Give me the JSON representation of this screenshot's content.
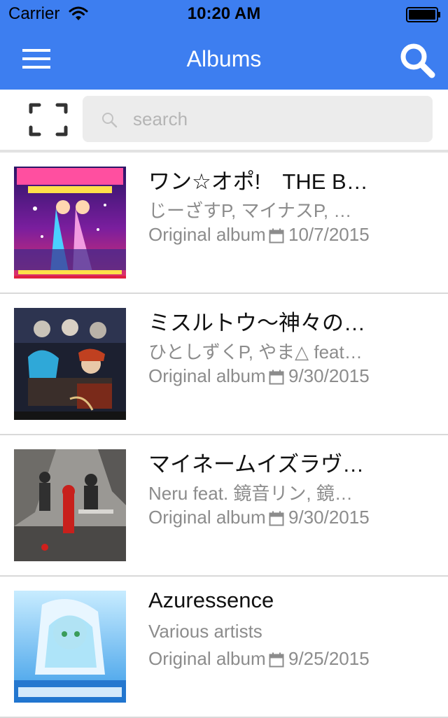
{
  "status_bar": {
    "carrier": "Carrier",
    "time": "10:20 AM"
  },
  "nav": {
    "title": "Albums",
    "menu_icon": "hamburger-menu-icon",
    "search_icon": "search-icon"
  },
  "search": {
    "placeholder": "search",
    "value": ""
  },
  "colors": {
    "accent": "#3d7ef0",
    "secondary_text": "#8c8c8c",
    "divider": "#d9d9d9"
  },
  "albums": [
    {
      "title": "ワン☆オポ!　THE BEST OF BEST!",
      "artists": "じーざすP, マイナスP, …",
      "type": "Original album",
      "date": "10/7/2015"
    },
    {
      "title": "ミスルトウ〜神々の宿り木〜",
      "artists": "ひとしずくP, やま△ feat. …",
      "type": "Original album",
      "date": "9/30/2015"
    },
    {
      "title": "マイネームイズラヴ…",
      "artists": "Neru feat. 鏡音リン, 鏡…",
      "type": "Original album",
      "date": "9/30/2015"
    },
    {
      "title": "Azuressence",
      "artists": "Various artists",
      "type": "Original album",
      "date": "9/25/2015"
    }
  ]
}
